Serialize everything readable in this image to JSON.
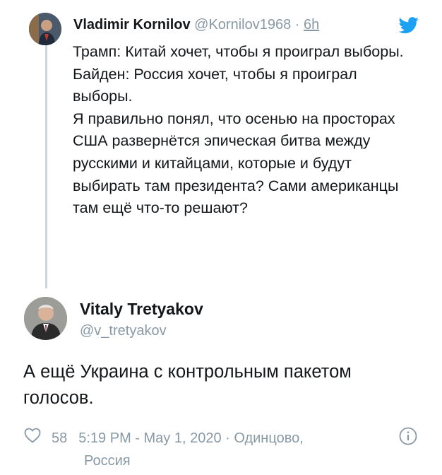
{
  "original_tweet": {
    "author_name": "Vladimir Kornilov",
    "handle": "@Kornilov1968",
    "separator": "·",
    "time": "6h",
    "lines": [
      "Трамп: Китай хочет, чтобы я проиграл выборы.",
      "Байден: Россия хочет, чтобы я проиграл выборы.",
      "Я правильно понял, что осенью на просторах США развернётся эпическая битва между русскими и китайцами, которые и будут выбирать там президента? Сами американцы там ещё что-то решают?"
    ]
  },
  "reply_tweet": {
    "author_name": "Vitaly Tretyakov",
    "handle": "@v_tretyakov",
    "text": "А ещё Украина с контрольным пакетом голосов."
  },
  "footer": {
    "likes": "58",
    "timestamp": "5:19 PM - May 1, 2020 · Одинцово,",
    "location_cont": "Россия"
  },
  "icons": {
    "twitter_logo": "twitter-bird-icon",
    "like": "heart-icon",
    "info": "info-icon"
  },
  "colors": {
    "twitter_blue": "#1da1f2",
    "text": "#14171a",
    "muted": "#8899a6",
    "thread_line": "#ccd6dd"
  }
}
